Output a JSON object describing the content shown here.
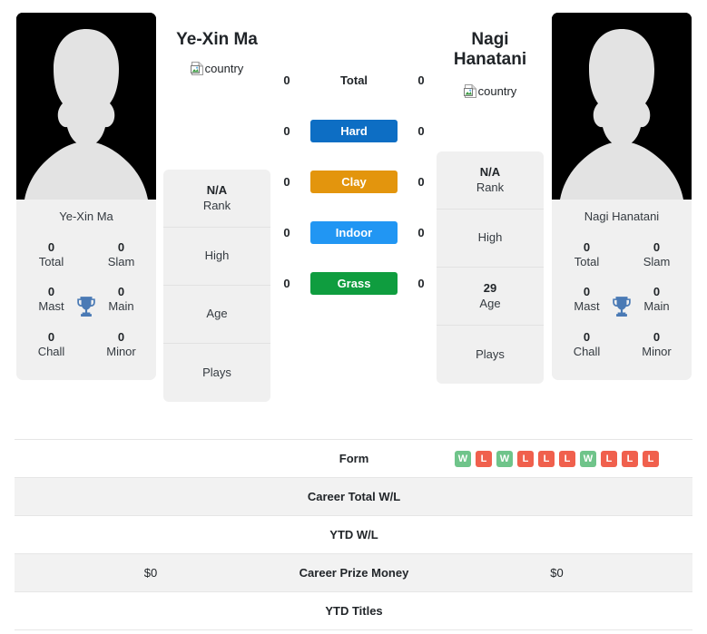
{
  "players": {
    "left": {
      "headline_name": "Ye-Xin Ma",
      "card_name": "Ye-Xin Ma",
      "country_alt": "country",
      "titles": [
        {
          "value": "0",
          "label": "Total"
        },
        {
          "value": "0",
          "label": "Slam"
        },
        {
          "value": "0",
          "label": "Mast"
        },
        {
          "value": "0",
          "label": "Main"
        },
        {
          "value": "0",
          "label": "Chall"
        },
        {
          "value": "0",
          "label": "Minor"
        }
      ],
      "info": [
        {
          "value": "N/A",
          "label": "Rank"
        },
        {
          "value": "",
          "label": "High"
        },
        {
          "value": "",
          "label": "Age"
        },
        {
          "value": "",
          "label": "Plays"
        }
      ]
    },
    "right": {
      "headline_name": "Nagi Hanatani",
      "card_name": "Nagi Hanatani",
      "country_alt": "country",
      "titles": [
        {
          "value": "0",
          "label": "Total"
        },
        {
          "value": "0",
          "label": "Slam"
        },
        {
          "value": "0",
          "label": "Mast"
        },
        {
          "value": "0",
          "label": "Main"
        },
        {
          "value": "0",
          "label": "Chall"
        },
        {
          "value": "0",
          "label": "Minor"
        }
      ],
      "info": [
        {
          "value": "N/A",
          "label": "Rank"
        },
        {
          "value": "",
          "label": "High"
        },
        {
          "value": "29",
          "label": "Age"
        },
        {
          "value": "",
          "label": "Plays"
        }
      ]
    }
  },
  "surfaces": [
    {
      "label": "Total",
      "left": "0",
      "right": "0",
      "color": "transparent",
      "plain": true
    },
    {
      "label": "Hard",
      "left": "0",
      "right": "0",
      "color": "#0d6ec4",
      "plain": false
    },
    {
      "label": "Clay",
      "left": "0",
      "right": "0",
      "color": "#e3950d",
      "plain": false
    },
    {
      "label": "Indoor",
      "left": "0",
      "right": "0",
      "color": "#2196f3",
      "plain": false
    },
    {
      "label": "Grass",
      "left": "0",
      "right": "0",
      "color": "#0f9d3f",
      "plain": false
    }
  ],
  "comparison_rows": [
    {
      "label": "Form",
      "left": "",
      "right": "",
      "shaded": false,
      "type": "form"
    },
    {
      "label": "Career Total W/L",
      "left": "",
      "right": "",
      "shaded": true,
      "type": "text"
    },
    {
      "label": "YTD W/L",
      "left": "",
      "right": "",
      "shaded": false,
      "type": "text"
    },
    {
      "label": "Career Prize Money",
      "left": "$0",
      "right": "$0",
      "shaded": true,
      "type": "text"
    },
    {
      "label": "YTD Titles",
      "left": "",
      "right": "",
      "shaded": false,
      "type": "text"
    }
  ],
  "form": {
    "right_results": [
      "W",
      "L",
      "W",
      "L",
      "L",
      "L",
      "W",
      "L",
      "L",
      "L"
    ],
    "win_color": "#6fc48a",
    "loss_color": "#f0604d"
  },
  "colors": {
    "card_bg": "#f0f0f0",
    "avatar_bg": "#000000",
    "silhouette": "#e3e3e3",
    "trophy": "#4a7ab5",
    "row_shade": "#f2f2f2"
  }
}
